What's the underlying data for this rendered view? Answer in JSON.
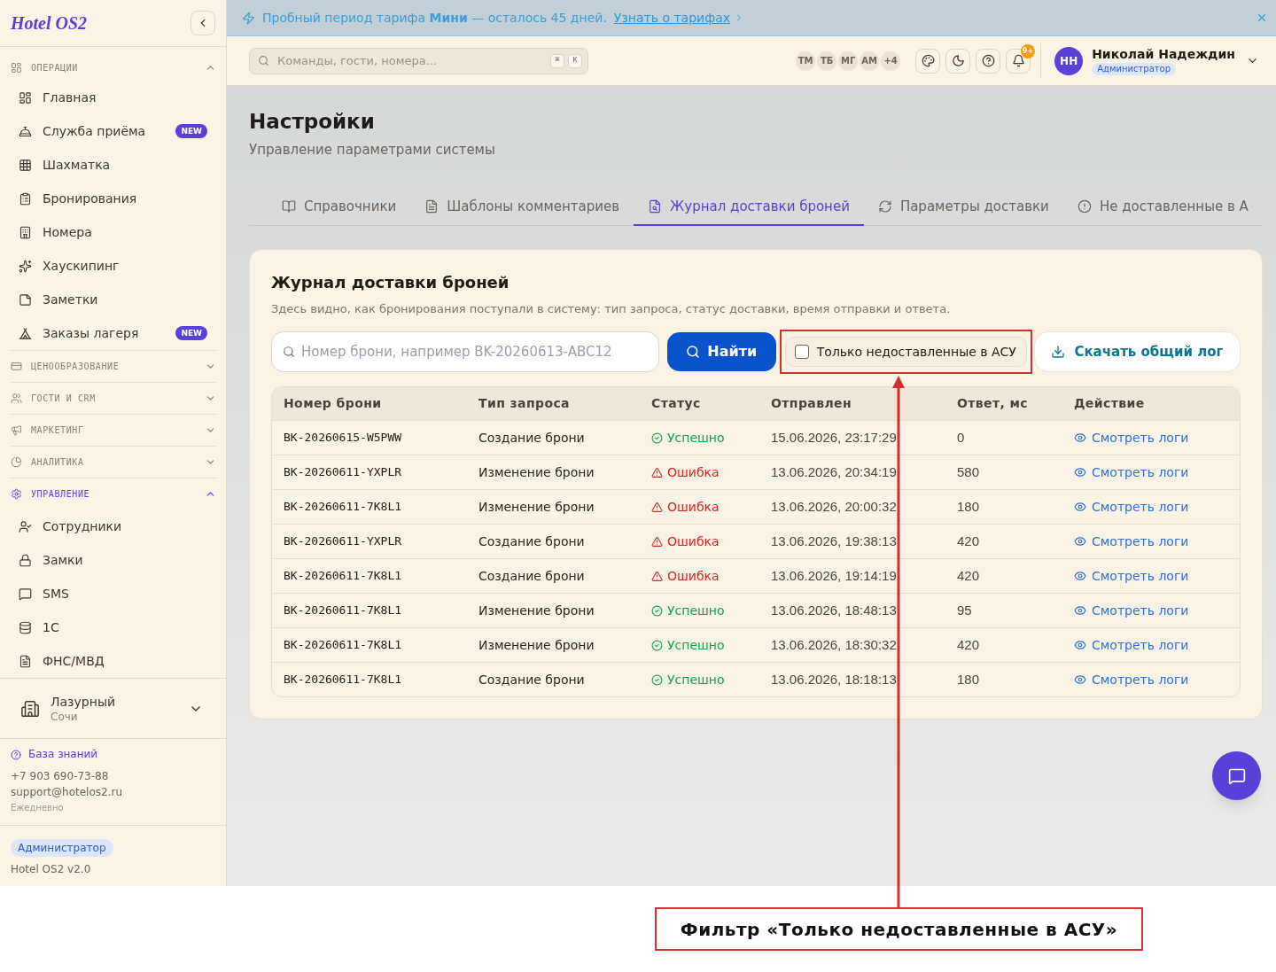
{
  "sidebar": {
    "logo": "Hotel OS2",
    "sections": [
      {
        "title": "ОПЕРАЦИИ",
        "expanded": true,
        "active": false,
        "items": [
          {
            "label": "Главная",
            "selected": false
          },
          {
            "label": "Служба приёма",
            "badge": "NEW",
            "selected": false
          },
          {
            "label": "Шахматка",
            "selected": false
          },
          {
            "label": "Бронирования",
            "selected": false
          },
          {
            "label": "Номера",
            "selected": false
          },
          {
            "label": "Хаускипинг",
            "selected": false
          },
          {
            "label": "Заметки",
            "selected": false
          },
          {
            "label": "Заказы лагеря",
            "badge": "NEW",
            "selected": false
          }
        ]
      },
      {
        "title": "ЦЕНООБРАЗОВАНИЕ",
        "expanded": false,
        "active": false
      },
      {
        "title": "ГОСТИ И CRM",
        "expanded": false,
        "active": false
      },
      {
        "title": "МАРКЕТИНГ",
        "expanded": false,
        "active": false
      },
      {
        "title": "АНАЛИТИКА",
        "expanded": false,
        "active": false
      },
      {
        "title": "УПРАВЛЕНИЕ",
        "expanded": true,
        "active": true,
        "items": [
          {
            "label": "Сотрудники",
            "selected": false
          },
          {
            "label": "Замки",
            "selected": false
          },
          {
            "label": "SMS",
            "selected": false
          },
          {
            "label": "1С",
            "selected": false
          },
          {
            "label": "ФНС/МВД",
            "selected": false
          }
        ]
      }
    ],
    "property": {
      "name": "Лазурный",
      "city": "Сочи"
    },
    "support": {
      "knowledge_base": "База знаний",
      "phone": "+7 903 690-73-88",
      "email": "support@hotelos2.ru",
      "hours": "Ежедневно"
    },
    "footer": {
      "role": "Администратор",
      "version": "Hotel OS2 v2.0"
    }
  },
  "banner": {
    "text": "Пробный период тарифа **Мини** — осталось 45 дней.",
    "link": "Узнать о тарифах"
  },
  "topbar": {
    "search": {
      "placeholder": "Команды, гости, номера...",
      "shortcut": [
        "⌘",
        "K"
      ]
    },
    "online_users": [
      "ТМ",
      "ТБ",
      "МГ",
      "АМ",
      "+4"
    ],
    "notifications_badge": "9+",
    "user": {
      "initials": "НН",
      "name": "Николай Надеждин",
      "role": "Администратор"
    }
  },
  "page": {
    "title": "Настройки",
    "subtitle": "Управление параметрами системы",
    "tabs": [
      {
        "label": "Справочники",
        "selected": false
      },
      {
        "label": "Шаблоны комментариев",
        "selected": false
      },
      {
        "label": "Журнал доставки броней",
        "selected": true
      },
      {
        "label": "Параметры доставки",
        "selected": false
      },
      {
        "label": "Не доставленные в А",
        "selected": false
      }
    ]
  },
  "journal": {
    "title": "Журнал доставки броней",
    "description": "Здесь видно, как бронирования поступали в систему: тип запроса, статус доставки, время отправки и ответа.",
    "search": {
      "placeholder": "Номер брони, например BK-20260613-ABC12"
    },
    "search_button": "Найти",
    "filter": {
      "label": "Только недоставленные в АСУ",
      "checked": false
    },
    "download_button": "Скачать общий лог",
    "table": {
      "columns": [
        "Номер брони",
        "Тип запроса",
        "Статус",
        "Отправлен",
        "Ответ, мс",
        "Действие"
      ],
      "rows": [
        {
          "booking": "BK-20260615-W5PWW",
          "request_type": "Создание брони",
          "status": {
            "kind": "success",
            "label": "Успешно"
          },
          "sent": "15.06.2026, 23:17:29",
          "response_ms": "0",
          "action": "Смотреть логи"
        },
        {
          "booking": "BK-20260611-YXPLR",
          "request_type": "Изменение брони",
          "status": {
            "kind": "error",
            "label": "Ошибка"
          },
          "sent": "13.06.2026, 20:34:19",
          "response_ms": "580",
          "action": "Смотреть логи"
        },
        {
          "booking": "BK-20260611-7K8L1",
          "request_type": "Изменение брони",
          "status": {
            "kind": "error",
            "label": "Ошибка"
          },
          "sent": "13.06.2026, 20:00:32",
          "response_ms": "180",
          "action": "Смотреть логи"
        },
        {
          "booking": "BK-20260611-YXPLR",
          "request_type": "Создание брони",
          "status": {
            "kind": "error",
            "label": "Ошибка"
          },
          "sent": "13.06.2026, 19:38:13",
          "response_ms": "420",
          "action": "Смотреть логи"
        },
        {
          "booking": "BK-20260611-7K8L1",
          "request_type": "Создание брони",
          "status": {
            "kind": "error",
            "label": "Ошибка"
          },
          "sent": "13.06.2026, 19:14:19",
          "response_ms": "420",
          "action": "Смотреть логи"
        },
        {
          "booking": "BK-20260611-7K8L1",
          "request_type": "Изменение брони",
          "status": {
            "kind": "success",
            "label": "Успешно"
          },
          "sent": "13.06.2026, 18:48:13",
          "response_ms": "95",
          "action": "Смотреть логи"
        },
        {
          "booking": "BK-20260611-7K8L1",
          "request_type": "Изменение брони",
          "status": {
            "kind": "success",
            "label": "Успешно"
          },
          "sent": "13.06.2026, 18:30:32",
          "response_ms": "420",
          "action": "Смотреть логи"
        },
        {
          "booking": "BK-20260611-7K8L1",
          "request_type": "Создание брони",
          "status": {
            "kind": "success",
            "label": "Успешно"
          },
          "sent": "13.06.2026, 18:18:13",
          "response_ms": "180",
          "action": "Смотреть логи"
        }
      ]
    }
  },
  "annotation": {
    "label": "Фильтр «Только недоставленные в АСУ»"
  }
}
